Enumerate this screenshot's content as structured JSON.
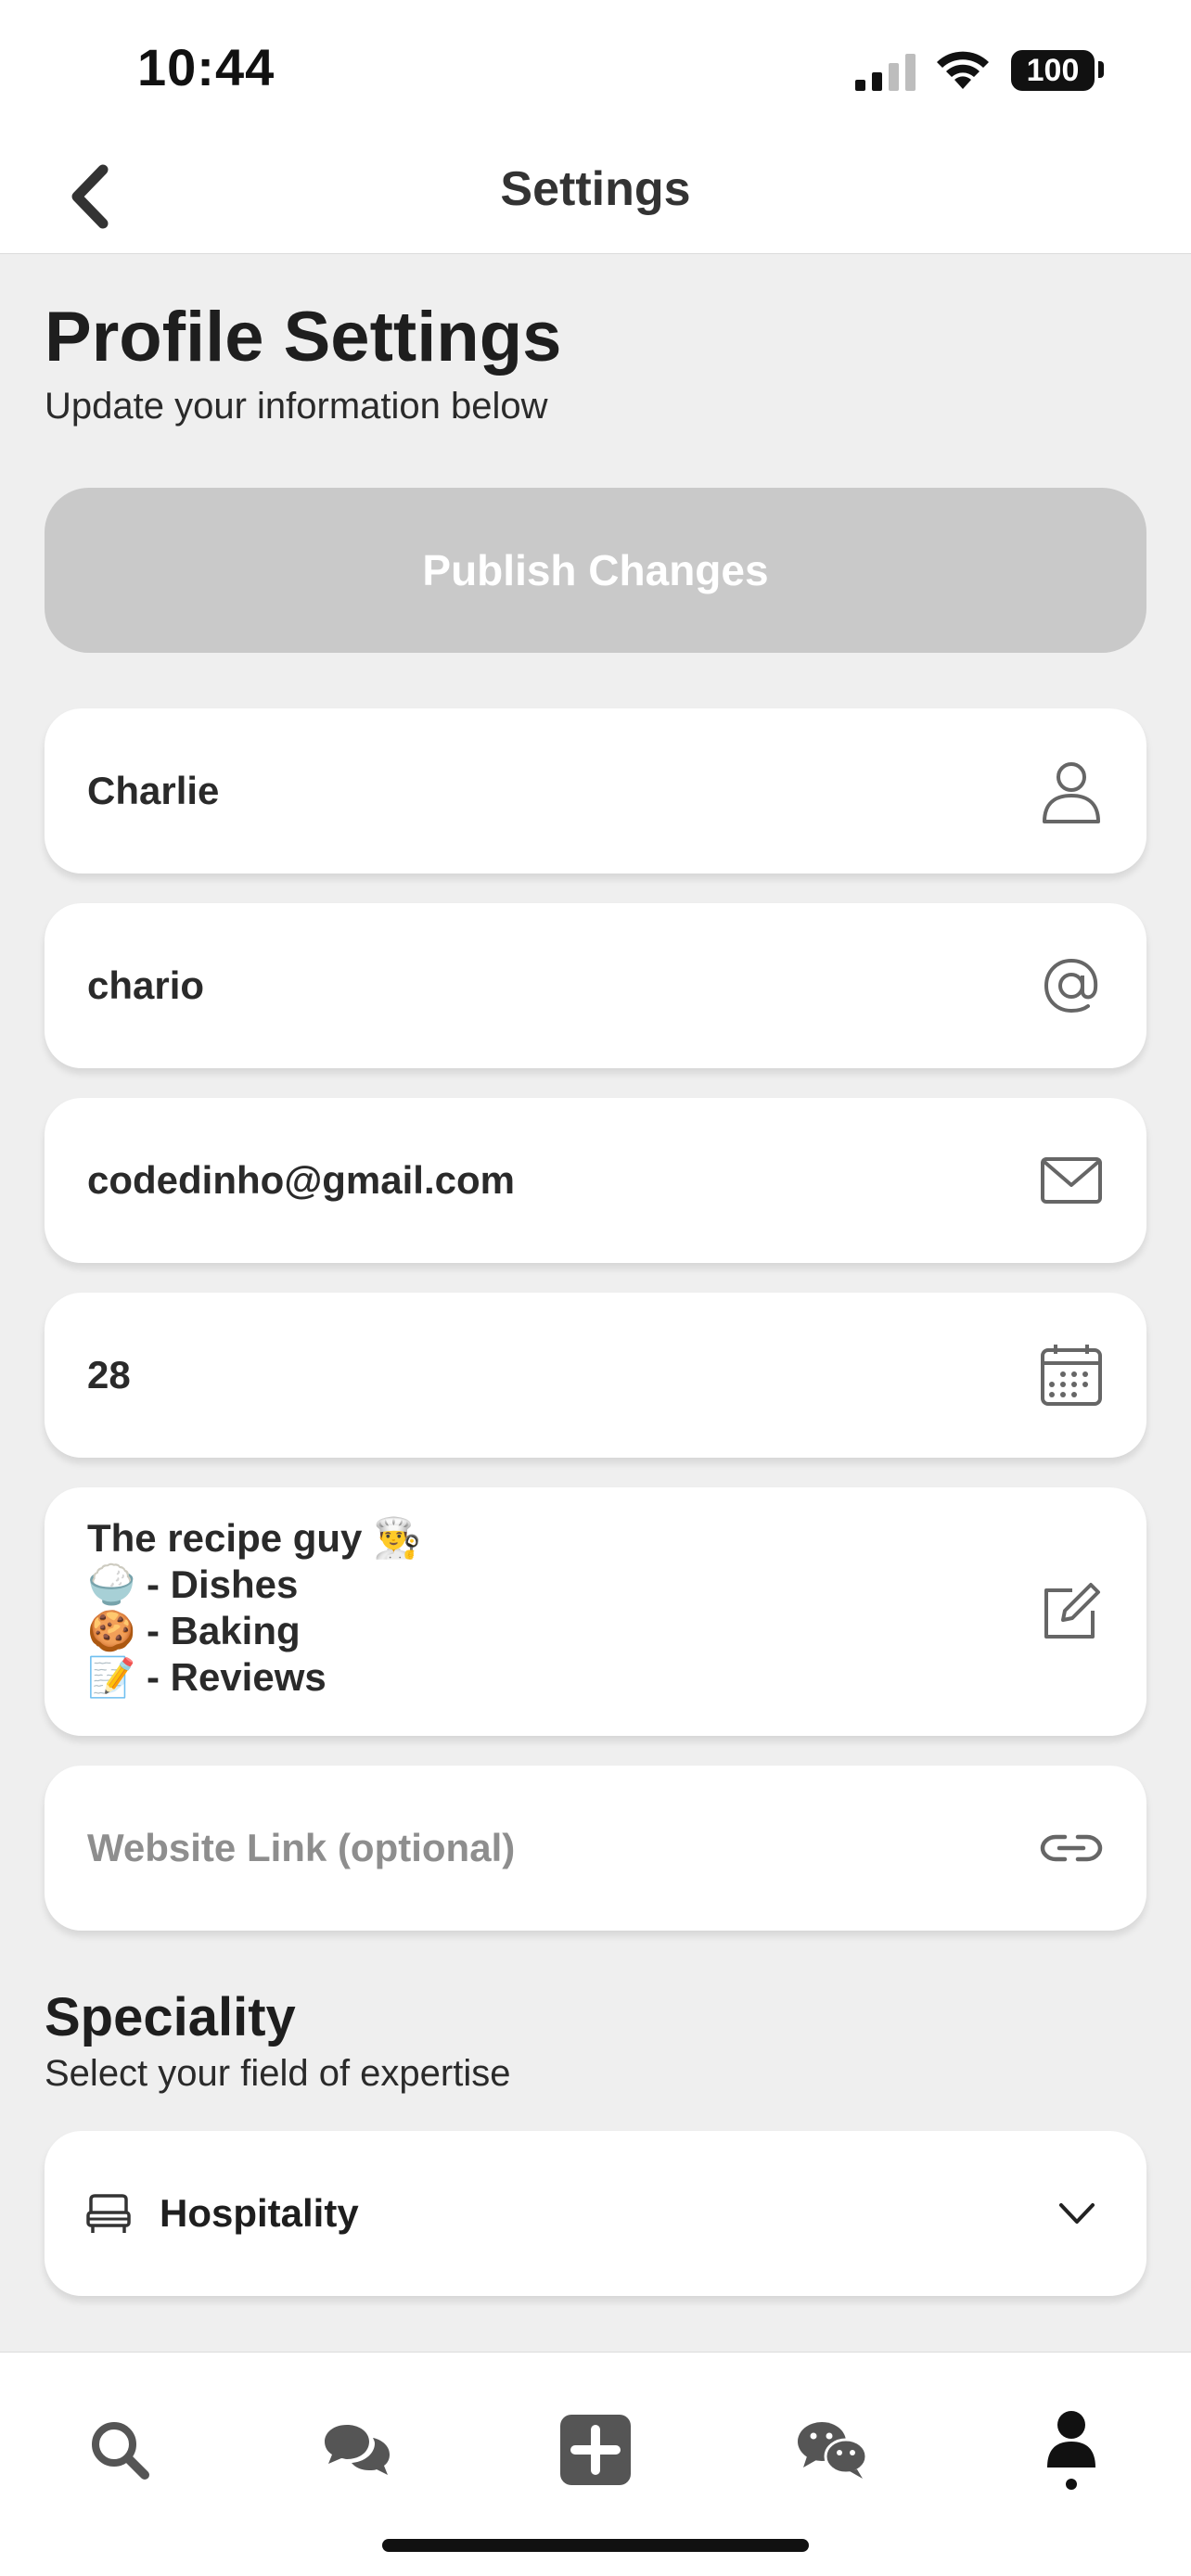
{
  "status_bar": {
    "time": "10:44",
    "battery": "100",
    "icons": [
      "signal-icon",
      "wifi-icon",
      "battery-icon"
    ]
  },
  "nav": {
    "title": "Settings",
    "back_icon": "chevron-left-icon"
  },
  "header": {
    "title": "Profile Settings",
    "subtitle": "Update your information below"
  },
  "publish_button": {
    "label": "Publish Changes",
    "state": "disabled",
    "color": "#c9c9c9"
  },
  "fields": {
    "name": {
      "value": "Charlie",
      "icon": "person-icon"
    },
    "username": {
      "value": "chario",
      "icon": "at-icon"
    },
    "email": {
      "value": "codedinho@gmail.com",
      "icon": "envelope-icon"
    },
    "age": {
      "value": "28",
      "icon": "calendar-icon"
    },
    "bio": {
      "lines": [
        "The recipe guy 👨‍🍳",
        "🍚 - Dishes",
        "🍪 - Baking",
        "📝 - Reviews"
      ],
      "icon": "edit-icon"
    },
    "website": {
      "placeholder": "Website Link (optional)",
      "value": "",
      "icon": "link-icon"
    }
  },
  "speciality": {
    "title": "Speciality",
    "subtitle": "Select your field of expertise",
    "selected": "Hospitality",
    "leading_icon": "bed-icon",
    "trailing_icon": "chevron-down-icon"
  },
  "tab_bar": {
    "tabs": [
      {
        "name": "search",
        "icon": "search-icon"
      },
      {
        "name": "messages",
        "icon": "chat-bubbles-icon"
      },
      {
        "name": "create",
        "icon": "plus-square-icon"
      },
      {
        "name": "community",
        "icon": "wechat-icon"
      },
      {
        "name": "profile",
        "icon": "person-filled-icon",
        "active": true
      }
    ]
  },
  "colors": {
    "background": "#efefef",
    "card": "#ffffff",
    "text": "#222222",
    "placeholder": "#8e8e8e",
    "icon": "#666666"
  }
}
